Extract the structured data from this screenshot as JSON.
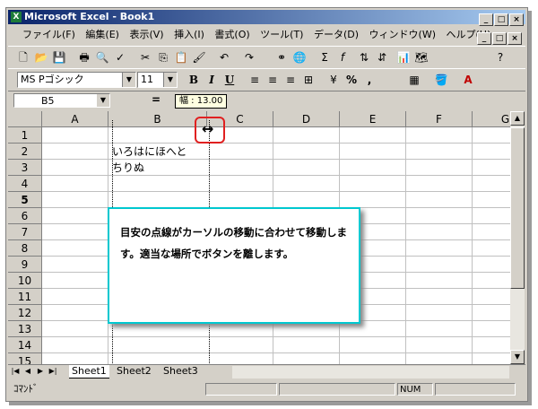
{
  "window": {
    "title": "Microsoft Excel - Book1",
    "app_icon_glyph": "X",
    "controls": {
      "minimize": "_",
      "maximize": "□",
      "close": "×"
    }
  },
  "menu": {
    "items": [
      "ファイル(F)",
      "編集(E)",
      "表示(V)",
      "挿入(I)",
      "書式(O)",
      "ツール(T)",
      "データ(D)",
      "ウィンドウ(W)",
      "ヘルプ(H)"
    ]
  },
  "toolbar": {
    "icons": [
      "new-icon",
      "open-icon",
      "save-icon",
      "print-icon",
      "print-preview-icon",
      "spelling-icon",
      "cut-icon",
      "copy-icon",
      "paste-icon",
      "format-painter-icon",
      "undo-icon",
      "redo-icon",
      "hyperlink-icon",
      "web-icon",
      "autosum-icon",
      "function-icon",
      "sort-ascending-icon",
      "sort-descending-icon",
      "chart-wizard-icon",
      "map-icon",
      "help-icon"
    ]
  },
  "formatting": {
    "font_name": "MS Pゴシック",
    "font_size": "11",
    "bold": "B",
    "italic": "I",
    "underline": "U",
    "percent": "%",
    "comma": ","
  },
  "formula_bar": {
    "name_box": "B5",
    "equals": "=",
    "tooltip": "幅 : 13.00"
  },
  "sheet": {
    "columns": [
      "A",
      "B",
      "C",
      "D",
      "E",
      "F",
      "G"
    ],
    "rows": [
      "1",
      "2",
      "3",
      "4",
      "5",
      "6",
      "7",
      "8",
      "9",
      "10",
      "11",
      "12",
      "13",
      "14",
      "15"
    ],
    "cells": {
      "B2": "いろはにほへと",
      "B3": "ちりぬ"
    }
  },
  "tabs": [
    "Sheet1",
    "Sheet2",
    "Sheet3"
  ],
  "status": {
    "mode": "ｺﾏﾝﾄﾞ",
    "num": "NUM"
  },
  "callout": {
    "text": "目安の点線がカーソルの移動に合わせて移動します。適当な場所でボタンを離します。"
  }
}
